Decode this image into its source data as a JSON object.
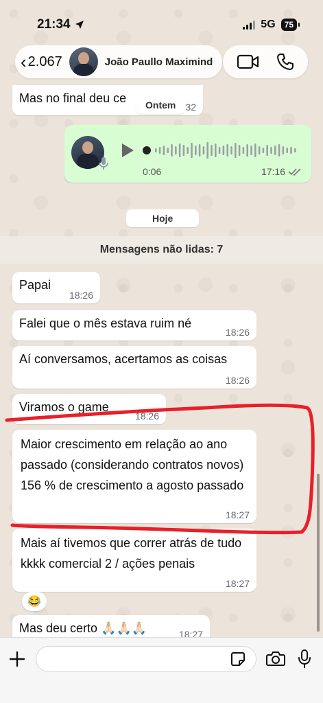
{
  "status_bar": {
    "time": "21:34",
    "network": "5G",
    "battery": "75"
  },
  "header": {
    "back_count": "2.067",
    "contact_name": "João Paullo Maximind"
  },
  "messages_above": {
    "partial_text": "Mas no final deu ce",
    "partial_time": "32",
    "date_pill_yesterday": "Ontem"
  },
  "voice_note": {
    "duration": "0:06",
    "time": "17:16"
  },
  "date_pill_today": "Hoje",
  "unread_banner": "Mensagens não lidas: 7",
  "messages": [
    {
      "text": "Papai",
      "time": "18:26"
    },
    {
      "text": "Falei que o mês estava ruim né",
      "time": "18:26"
    },
    {
      "text": "Aí conversamos, acertamos as coisas",
      "time": "18:26"
    },
    {
      "text": "Viramos o game",
      "time": "18:26"
    },
    {
      "text": "Maior crescimento em relação ao ano passado (considerando contratos novos) 156 % de crescimento a agosto passado",
      "time": "18:27"
    },
    {
      "text": "Mais aí tivemos que correr atrás de tudo kkkk comercial 2 / ações penais",
      "time": "18:27"
    },
    {
      "text": "Mas deu certo 🙏🏻🙏🏻🙏🏻",
      "time": "18:27"
    }
  ],
  "reaction": "😂",
  "annotation_color": "#e8202a",
  "accent_green": "#d9fdd3"
}
